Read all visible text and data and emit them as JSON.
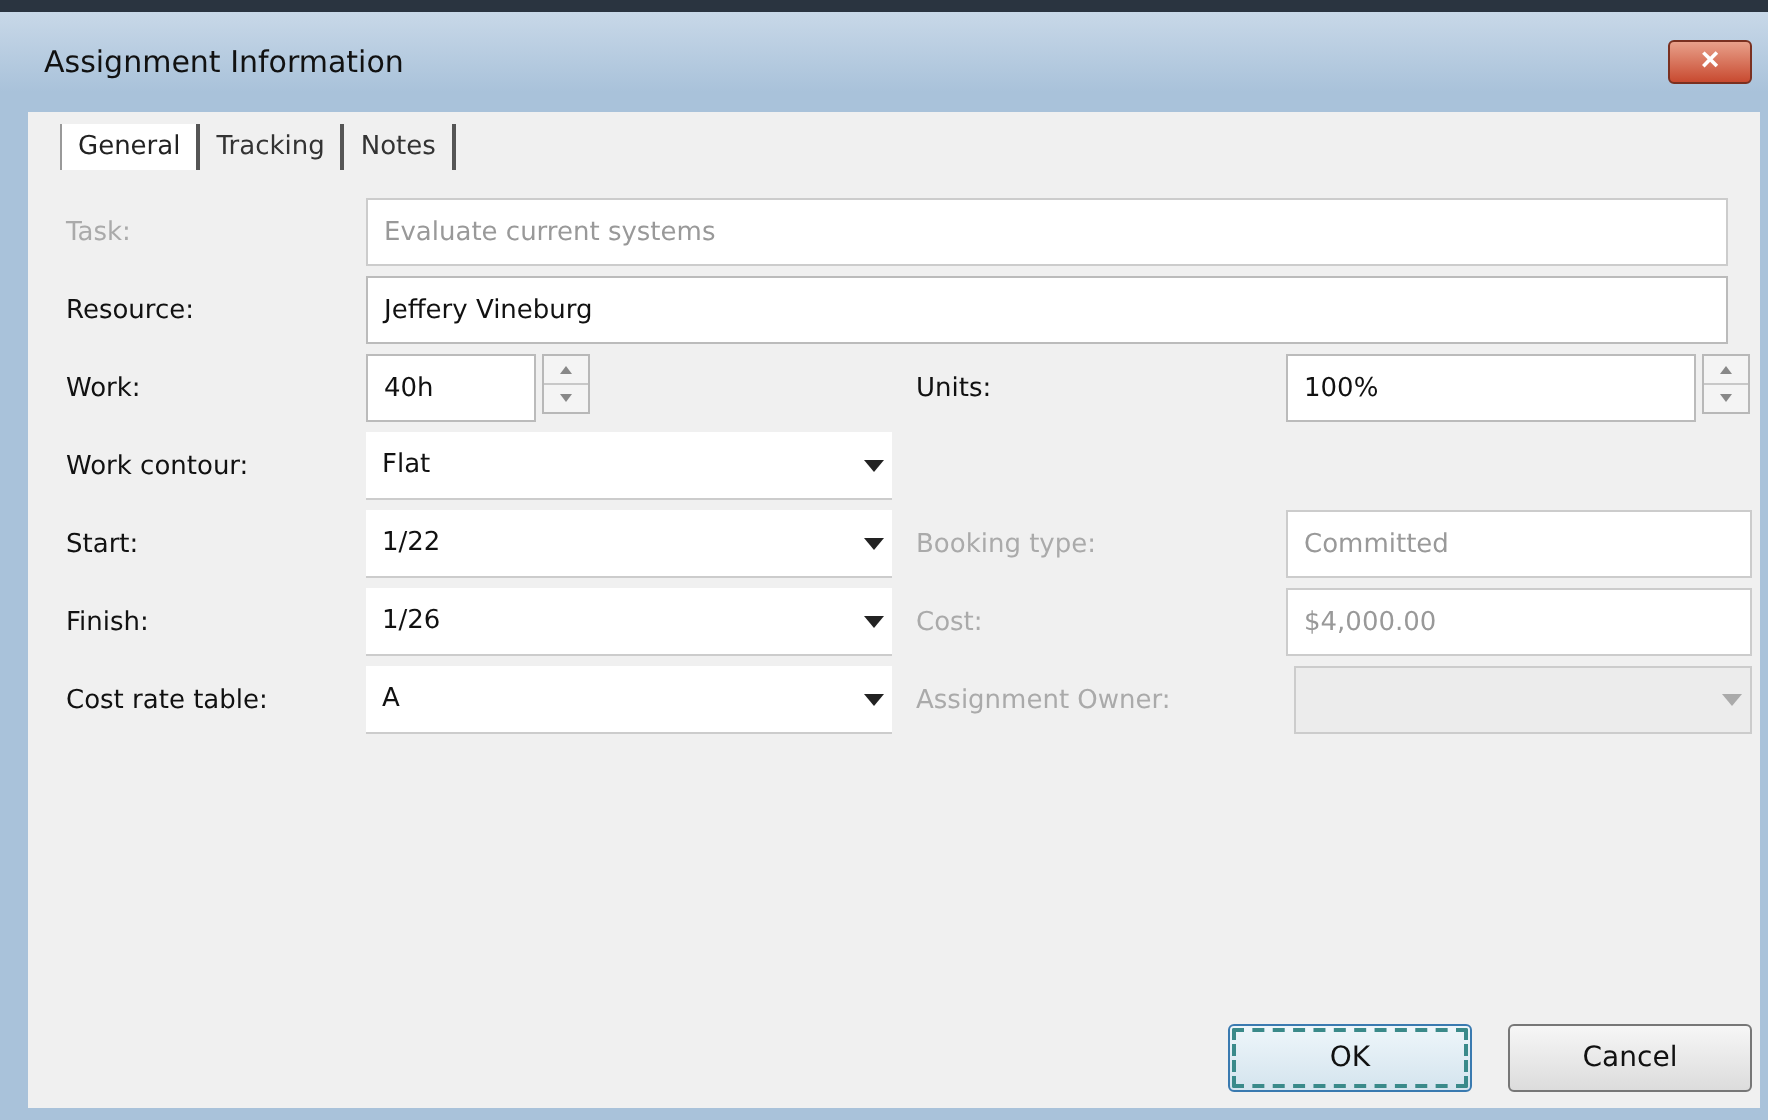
{
  "window": {
    "title": "Assignment Information",
    "close": "×"
  },
  "tabs": [
    {
      "label": "General",
      "selected": true
    },
    {
      "label": "Tracking",
      "selected": false
    },
    {
      "label": "Notes",
      "selected": false
    }
  ],
  "rows": [
    {
      "left": {
        "label": "Task:",
        "kind": "wide",
        "value": "Evaluate current systems",
        "disabled": true
      }
    },
    {
      "left": {
        "label": "Resource:",
        "kind": "wide",
        "value": "Jeffery Vineburg",
        "disabled": false
      }
    },
    {
      "left": {
        "label": "Work:",
        "kind": "spin",
        "value": "40h",
        "disabled": false
      },
      "right": {
        "label": "Units:",
        "kind": "spin",
        "value": "100%",
        "disabled": false
      }
    },
    {
      "left": {
        "label": "Work contour:",
        "kind": "combo",
        "value": "Flat",
        "disabled": false
      }
    },
    {
      "left": {
        "label": "Start:",
        "kind": "combo",
        "value": "1/22",
        "disabled": false
      },
      "right": {
        "label": "Booking type:",
        "kind": "text",
        "value": "Committed",
        "disabled": true
      }
    },
    {
      "left": {
        "label": "Finish:",
        "kind": "combo",
        "value": "1/26",
        "disabled": false
      },
      "right": {
        "label": "Cost:",
        "kind": "text",
        "value": "$4,000.00",
        "disabled": true
      }
    },
    {
      "left": {
        "label": "Cost rate table:",
        "kind": "combo",
        "value": "A",
        "disabled": false
      },
      "right": {
        "label": "Assignment Owner:",
        "kind": "combo",
        "disabled": true
      }
    }
  ],
  "buttons": [
    {
      "label": "OK",
      "default": true
    },
    {
      "label": "Cancel",
      "default": false
    }
  ]
}
